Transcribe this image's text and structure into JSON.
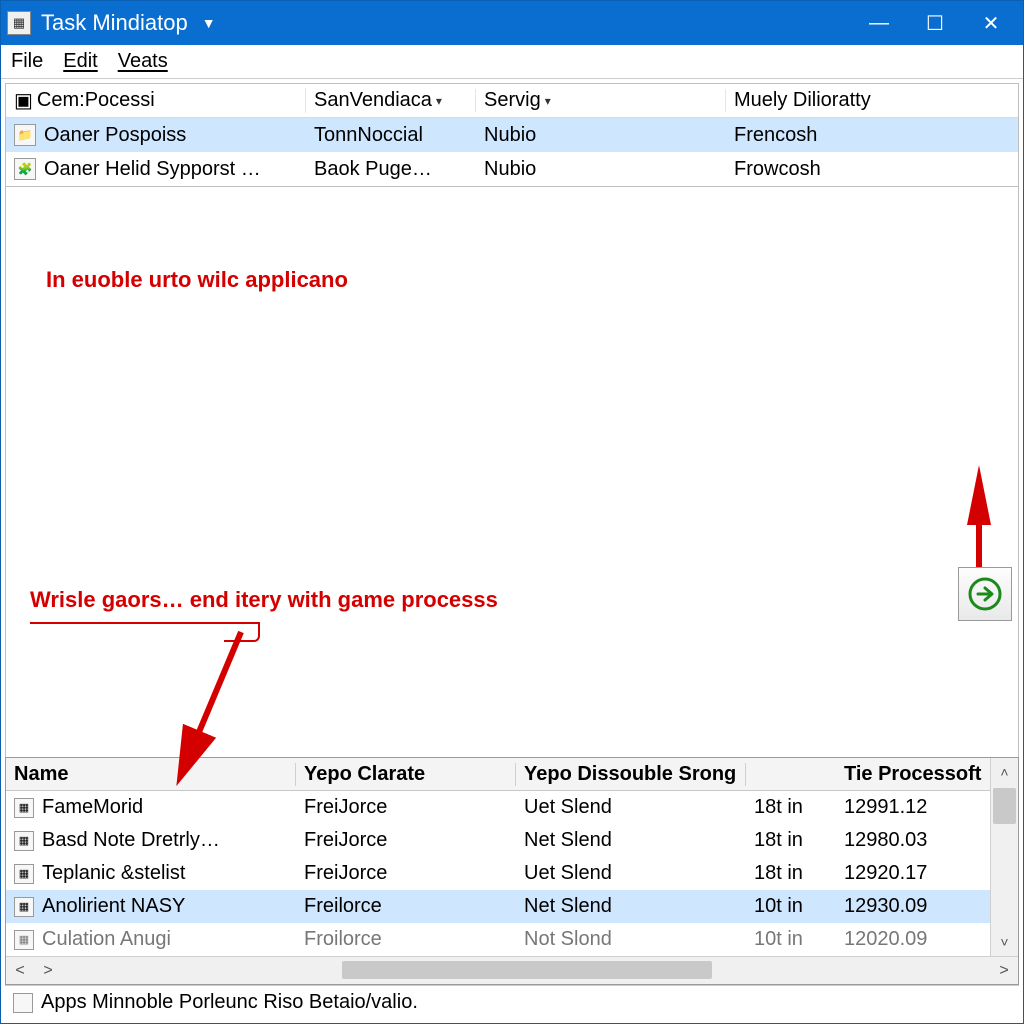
{
  "titlebar": {
    "title": "Task Mindiatop"
  },
  "menubar": {
    "items": [
      "File",
      "Edit",
      "Veats"
    ]
  },
  "upper": {
    "columns": [
      "Cem:Pocessi",
      "SanVendiaca",
      "Servig",
      "Muely Dilioratty"
    ],
    "rows": [
      {
        "icon": "folder-icon",
        "name": "Oaner Pospoiss",
        "c1": "TonnNoccial",
        "c2": "Nubio",
        "c3": "Frencosh",
        "selected": true
      },
      {
        "icon": "program-icon",
        "name": "Oaner Helid Sypporst …",
        "c1": "Baok Puge…",
        "c2": "Nubio",
        "c3": "Frowcosh",
        "selected": false
      }
    ]
  },
  "annotations": {
    "line1": "In euoble urto wilc applicano",
    "line2": "Wrisle gaors… end itery with game processs"
  },
  "lower": {
    "columns": [
      "Name",
      "Yepo Clarate",
      "Yepo Dissouble Srong",
      "",
      "Tie Processoft"
    ],
    "rows": [
      {
        "icon": "app-icon",
        "name": "FameMorid",
        "c1": "FreiJorce",
        "c2": "Uet Slend",
        "c3": "18t in",
        "c4": "12991.12",
        "selected": false
      },
      {
        "icon": "app-icon",
        "name": "Basd Note Dretrly…",
        "c1": "FreiJorce",
        "c2": "Net Slend",
        "c3": "18t in",
        "c4": "12980.03",
        "selected": false
      },
      {
        "icon": "app-icon",
        "name": "Teplanic &stelist",
        "c1": "FreiJorce",
        "c2": "Uet Slend",
        "c3": "18t in",
        "c4": "12920.17",
        "selected": false
      },
      {
        "icon": "app-icon",
        "name": "Anolirient NASY",
        "c1": "Freilorce",
        "c2": "Net Slend",
        "c3": "10t in",
        "c4": "12930.09",
        "selected": true
      },
      {
        "icon": "app-icon",
        "name": "Culation Anugi",
        "c1": "Froilorce",
        "c2": "Not Slond",
        "c3": "10t in",
        "c4": "12020.09",
        "selected": false,
        "partial": true
      }
    ]
  },
  "statusbar": {
    "text": "Apps Minnoble Porleunc Riso Betaio/valio."
  }
}
